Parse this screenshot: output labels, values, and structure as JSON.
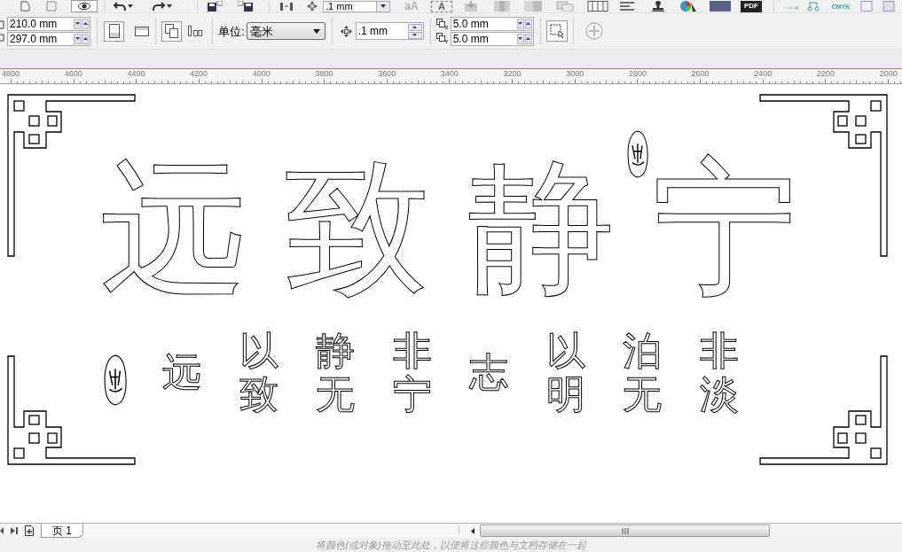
{
  "standard_toolbar": {
    "preview_on": true,
    "nudge_field": ".1 mm",
    "font_size_label": "aA",
    "frame_text_label": "A",
    "pdf_label": "PDF",
    "color_mode_label": "CMYK"
  },
  "property_bar": {
    "page_width": "210.0 mm",
    "page_height": "297.0 mm",
    "orientations": [
      {
        "kind": "portrait",
        "selected": true
      },
      {
        "kind": "landscape",
        "selected": false
      }
    ],
    "page_scope": [
      {
        "kind": "all_pages",
        "selected": true
      },
      {
        "kind": "current_page",
        "selected": false
      }
    ],
    "units_label": "单位:",
    "units_value": "毫米",
    "nudge_distance": ".1 mm",
    "duplicate_x": "5.0 mm",
    "duplicate_y": "5.0 mm"
  },
  "ruler": {
    "labels": [
      "4800",
      "4600",
      "4400",
      "4200",
      "4000",
      "3800",
      "3600",
      "3400",
      "3200",
      "3000",
      "2800",
      "2600",
      "2400",
      "2200",
      "2000"
    ]
  },
  "artwork": {
    "title_characters": [
      "远",
      "致",
      "静",
      "宁"
    ],
    "couplet_columns": [
      "远",
      "以致",
      "静无",
      "非宁",
      "志",
      "以明",
      "泊无",
      "非淡"
    ]
  },
  "page_tabs": [
    {
      "label": "页 1",
      "selected": true
    }
  ],
  "status_bar": {
    "hint": "将颜色(或对象)拖动至此处，以便将这些颜色与文档存储在一起"
  }
}
